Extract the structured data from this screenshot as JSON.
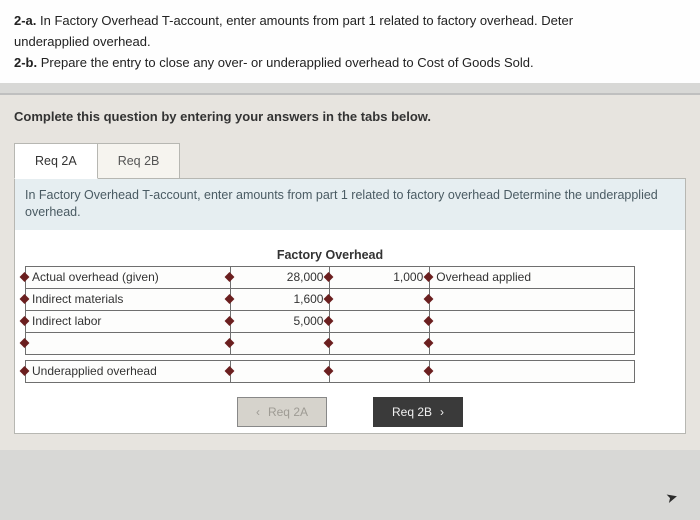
{
  "question": {
    "part_a_label": "2-a.",
    "part_a_text": " In Factory Overhead T-account, enter amounts from part 1 related to factory overhead. Deter",
    "part_a_line2": "underapplied overhead.",
    "part_b_label": "2-b.",
    "part_b_text": " Prepare the entry to close any over- or underapplied overhead to Cost of Goods Sold."
  },
  "instruction": "Complete this question by entering your answers in the tabs below.",
  "tabs": {
    "a": "Req 2A",
    "b": "Req 2B"
  },
  "panel": {
    "desc": "In Factory Overhead T-account, enter amounts from part 1 related to factory overhead Determine the underapplied overhead."
  },
  "taccount": {
    "title": "Factory Overhead",
    "rows_left": [
      {
        "label": "Actual overhead (given)",
        "amount": "28,000"
      },
      {
        "label": "Indirect materials",
        "amount": "1,600"
      },
      {
        "label": "Indirect labor",
        "amount": "5,000"
      },
      {
        "label": "",
        "amount": ""
      }
    ],
    "rows_right": [
      {
        "amount": "1,000",
        "label": "Overhead applied"
      },
      {
        "amount": "",
        "label": ""
      },
      {
        "amount": "",
        "label": ""
      },
      {
        "amount": "",
        "label": ""
      }
    ],
    "bottom_left_label": "Underapplied overhead",
    "bottom_left_amount": "",
    "bottom_right_amount": "",
    "bottom_right_label": ""
  },
  "nav": {
    "prev": "Req 2A",
    "next": "Req 2B"
  },
  "chart_data": {
    "type": "table",
    "title": "Factory Overhead",
    "debit": [
      {
        "label": "Actual overhead (given)",
        "value": 28000
      },
      {
        "label": "Indirect materials",
        "value": 1600
      },
      {
        "label": "Indirect labor",
        "value": 5000
      }
    ],
    "credit": [
      {
        "label": "Overhead applied",
        "value": 1000
      }
    ],
    "result_row": {
      "label": "Underapplied overhead",
      "value": null
    }
  }
}
